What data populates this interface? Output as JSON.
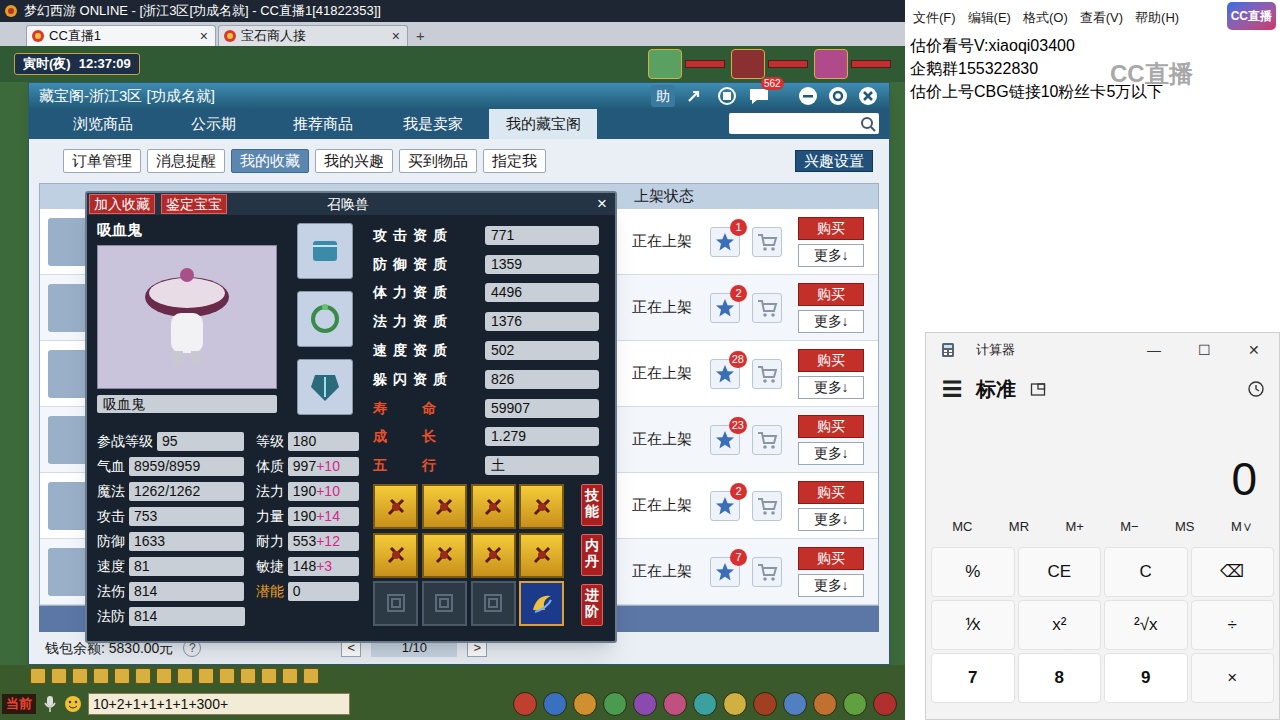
{
  "browser": {
    "title": "梦幻西游 ONLINE - [浙江3区[功成名就] - CC直播1[41822353]]",
    "tabs": [
      {
        "label": "CC直播1",
        "close": "×",
        "selected": true
      },
      {
        "label": "宝石商人接",
        "close": "×",
        "selected": false
      }
    ],
    "new_tab": "+"
  },
  "game": {
    "period": "寅时(夜)",
    "time": "12:37:09",
    "chat_channel": "当前",
    "chat_input": "10+2+1+1+1+1+300+"
  },
  "cbg": {
    "title": "藏宝阁-浙江3区 [功成名就]",
    "help": "助",
    "message_badge": "562",
    "tabs": [
      {
        "label": "浏览商品",
        "selected": false
      },
      {
        "label": "公示期",
        "selected": false
      },
      {
        "label": "推荐商品",
        "selected": false
      },
      {
        "label": "我是卖家",
        "selected": false
      },
      {
        "label": "我的藏宝阁",
        "selected": true
      }
    ],
    "subtabs": [
      {
        "label": "订单管理",
        "selected": false
      },
      {
        "label": "消息提醒",
        "selected": false
      },
      {
        "label": "我的收藏",
        "selected": true
      },
      {
        "label": "我的兴趣",
        "selected": false
      },
      {
        "label": "买到物品",
        "selected": false
      },
      {
        "label": "指定我",
        "selected": false
      }
    ],
    "interest_button": "兴趣设置",
    "status_header": "上架状态",
    "rows": [
      {
        "status": "正在上架",
        "favorites": "1",
        "buy": "购买",
        "more": "更多↓"
      },
      {
        "status": "正在上架",
        "favorites": "2",
        "buy": "购买",
        "more": "更多↓"
      },
      {
        "status": "正在上架",
        "favorites": "28",
        "buy": "购买",
        "more": "更多↓"
      },
      {
        "status": "正在上架",
        "favorites": "23",
        "buy": "购买",
        "more": "更多↓"
      },
      {
        "status": "正在上架",
        "favorites": "2",
        "buy": "购买",
        "more": "更多↓"
      },
      {
        "status": "正在上架",
        "favorites": "7",
        "buy": "购买",
        "more": "更多↓"
      }
    ],
    "wallet": "钱包余额: 5830.00元",
    "help_mark": "?",
    "prev": "<",
    "page": "1/10",
    "next": ">"
  },
  "pet": {
    "add_favorite": "加入收藏",
    "appraise": "鉴定宝宝",
    "title": "召唤兽",
    "close": "×",
    "name": "吸血鬼",
    "name_field": "吸血鬼",
    "aptitudes": [
      {
        "label": "攻击资质",
        "value": "771",
        "highlight": false
      },
      {
        "label": "防御资质",
        "value": "1359",
        "highlight": false
      },
      {
        "label": "体力资质",
        "value": "4496",
        "highlight": false
      },
      {
        "label": "法力资质",
        "value": "1376",
        "highlight": false
      },
      {
        "label": "速度资质",
        "value": "502",
        "highlight": false
      },
      {
        "label": "躲闪资质",
        "value": "826",
        "highlight": false
      },
      {
        "label": "寿命",
        "value": "59907",
        "highlight": true
      },
      {
        "label": "成长",
        "value": "1.279",
        "highlight": true
      },
      {
        "label": "五行",
        "value": "土",
        "highlight": true
      }
    ],
    "stats": [
      [
        {
          "label": "参战等级",
          "value": "95",
          "bonus": "",
          "highlight": false
        },
        {
          "label": "等级",
          "value": "180",
          "bonus": "",
          "highlight": false
        }
      ],
      [
        {
          "label": "气血",
          "value": "8959/8959",
          "bonus": "",
          "highlight": false
        },
        {
          "label": "体质",
          "value": "997",
          "bonus": "+10",
          "highlight": false
        }
      ],
      [
        {
          "label": "魔法",
          "value": "1262/1262",
          "bonus": "",
          "highlight": false
        },
        {
          "label": "法力",
          "value": "190",
          "bonus": "+10",
          "highlight": false
        }
      ],
      [
        {
          "label": "攻击",
          "value": "753",
          "bonus": "",
          "highlight": false
        },
        {
          "label": "力量",
          "value": "190",
          "bonus": "+14",
          "highlight": false
        }
      ],
      [
        {
          "label": "防御",
          "value": "1633",
          "bonus": "",
          "highlight": false
        },
        {
          "label": "耐力",
          "value": "553",
          "bonus": "+12",
          "highlight": false
        }
      ],
      [
        {
          "label": "速度",
          "value": "81",
          "bonus": "",
          "highlight": false
        },
        {
          "label": "敏捷",
          "value": "148",
          "bonus": "+3",
          "highlight": false
        }
      ],
      [
        {
          "label": "法伤",
          "value": "814",
          "bonus": "",
          "highlight": false
        },
        {
          "label": "潜能",
          "value": "0",
          "bonus": "",
          "highlight": true
        }
      ],
      [
        {
          "label": "法防",
          "value": "814",
          "bonus": "",
          "highlight": false
        }
      ]
    ],
    "skills": [
      {
        "kind": "normal"
      },
      {
        "kind": "normal"
      },
      {
        "kind": "normal"
      },
      {
        "kind": "normal"
      },
      {
        "kind": "normal"
      },
      {
        "kind": "normal"
      },
      {
        "kind": "normal"
      },
      {
        "kind": "normal"
      },
      {
        "kind": "empty"
      },
      {
        "kind": "empty"
      },
      {
        "kind": "empty"
      },
      {
        "kind": "special"
      }
    ],
    "side_buttons": [
      "技能",
      "内丹",
      "进阶"
    ]
  },
  "notepad": {
    "menu": [
      "文件(F)",
      "编辑(E)",
      "格式(O)",
      "查看(V)",
      "帮助(H)"
    ],
    "lines": [
      "估价看号V:xiaoqi03400",
      "企鹅群155322830",
      "估价上号CBG链接10粉丝卡5万以下"
    ]
  },
  "logo": "CC直播",
  "watermark": "CC直播",
  "calculator": {
    "title": "计算器",
    "controls": [
      "—",
      "☐",
      "✕"
    ],
    "menu": "☰",
    "mode": "标准",
    "display": "0",
    "memory": [
      "MC",
      "MR",
      "M+",
      "M−",
      "MS",
      "M∨"
    ],
    "keys": [
      [
        {
          "label": "%",
          "kind": "op"
        },
        {
          "label": "CE",
          "kind": "op"
        },
        {
          "label": "C",
          "kind": "op"
        },
        {
          "label": "⌫",
          "kind": "op"
        }
      ],
      [
        {
          "label": "⅟x",
          "kind": "op"
        },
        {
          "label": "x²",
          "kind": "op"
        },
        {
          "label": "²√x",
          "kind": "op"
        },
        {
          "label": "÷",
          "kind": "op"
        }
      ],
      [
        {
          "label": "7",
          "kind": "digit"
        },
        {
          "label": "8",
          "kind": "digit"
        },
        {
          "label": "9",
          "kind": "digit"
        },
        {
          "label": "×",
          "kind": "op"
        }
      ]
    ]
  }
}
